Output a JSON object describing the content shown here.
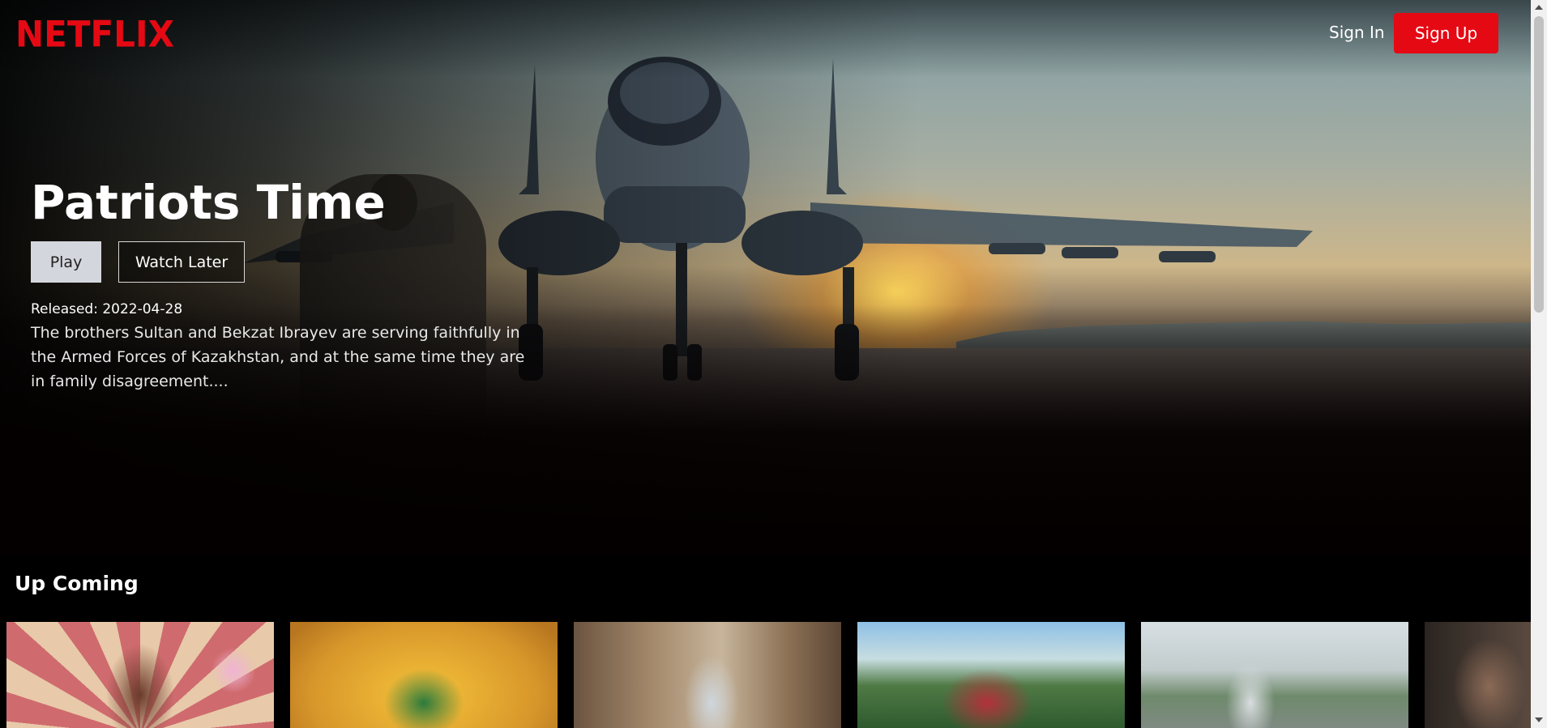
{
  "header": {
    "logo": "NETFLIX",
    "sign_in": "Sign In",
    "sign_up": "Sign Up"
  },
  "hero": {
    "title": "Patriots Time",
    "play_label": "Play",
    "watch_later_label": "Watch Later",
    "released": "Released: 2022-04-28",
    "description": "The brothers Sultan and Bekzat Ibrayev are serving faithfully in the Armed Forces of Kazakhstan, and at the same time they are in family disagreement...."
  },
  "row": {
    "title": "Up Coming"
  },
  "colors": {
    "brand_red": "#e50914",
    "background": "#000000",
    "play_button": "#d4d6dd"
  }
}
